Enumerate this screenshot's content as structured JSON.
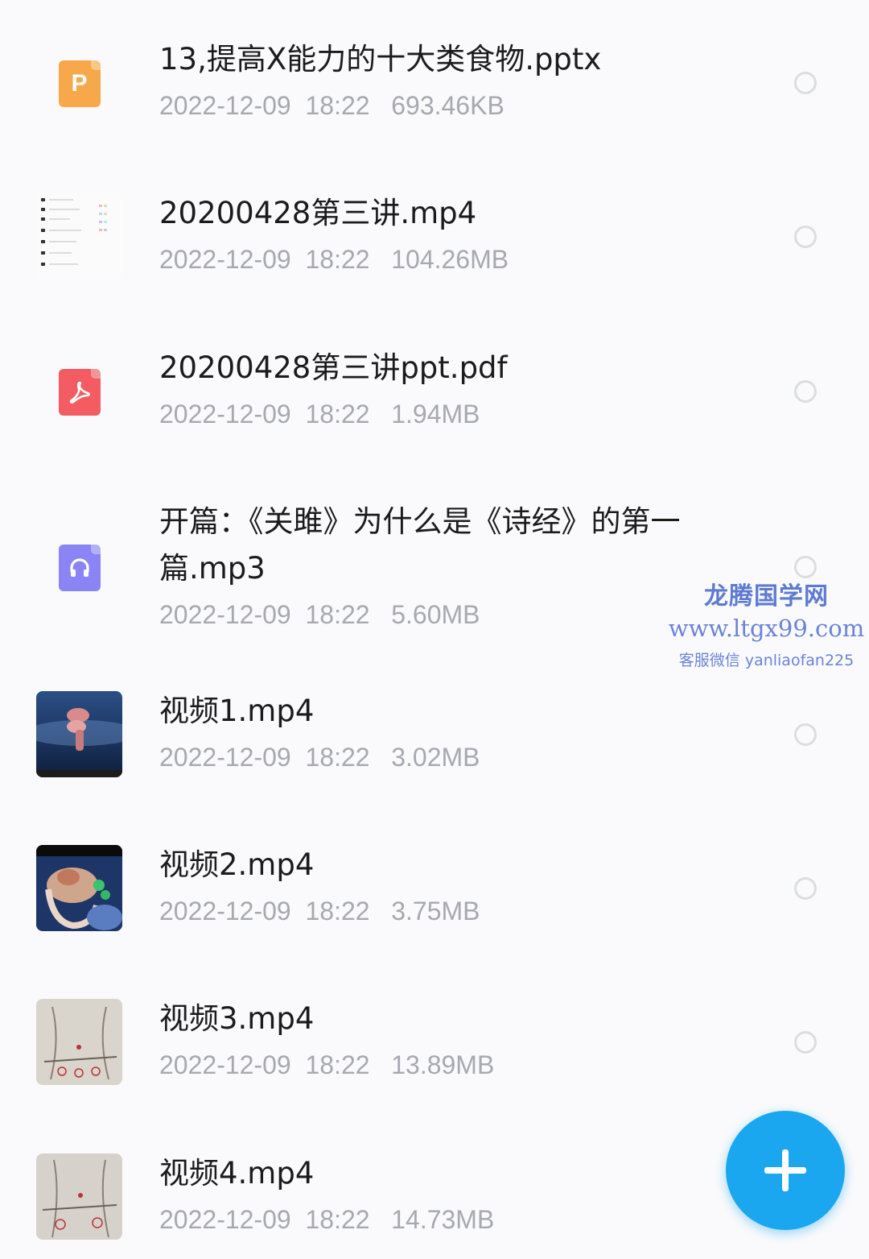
{
  "files": [
    {
      "name": "13,提高X能力的十大类食物.pptx",
      "date": "2022-12-09",
      "time": "18:22",
      "size": "693.46KB",
      "icon": "pptx-file-icon",
      "icon_glyph": "P"
    },
    {
      "name": "20200428第三讲.mp4",
      "date": "2022-12-09",
      "time": "18:22",
      "size": "104.26MB",
      "icon": "video-thumbnail"
    },
    {
      "name": "20200428第三讲ppt.pdf",
      "date": "2022-12-09",
      "time": "18:22",
      "size": "1.94MB",
      "icon": "pdf-file-icon"
    },
    {
      "name": "开篇：《关雎》为什么是《诗经》的第一篇.mp3",
      "date": "2022-12-09",
      "time": "18:22",
      "size": "5.60MB",
      "icon": "audio-file-icon"
    },
    {
      "name": "视频1.mp4",
      "date": "2022-12-09",
      "time": "18:22",
      "size": "3.02MB",
      "icon": "video-thumbnail"
    },
    {
      "name": "视频2.mp4",
      "date": "2022-12-09",
      "time": "18:22",
      "size": "3.75MB",
      "icon": "video-thumbnail"
    },
    {
      "name": "视频3.mp4",
      "date": "2022-12-09",
      "time": "18:22",
      "size": "13.89MB",
      "icon": "video-thumbnail"
    },
    {
      "name": "视频4.mp4",
      "date": "2022-12-09",
      "time": "18:22",
      "size": "14.73MB",
      "icon": "video-thumbnail"
    }
  ],
  "watermark": {
    "title": "龙腾国学网",
    "url": "www.ltgx99.com",
    "contact": "客服微信 yanliaofan225"
  },
  "fab": {
    "icon": "plus-icon"
  },
  "colors": {
    "accent": "#1aa7ef",
    "pptx": "#f7a84a",
    "pdf": "#f25c62",
    "audio": "#8a84f5"
  }
}
